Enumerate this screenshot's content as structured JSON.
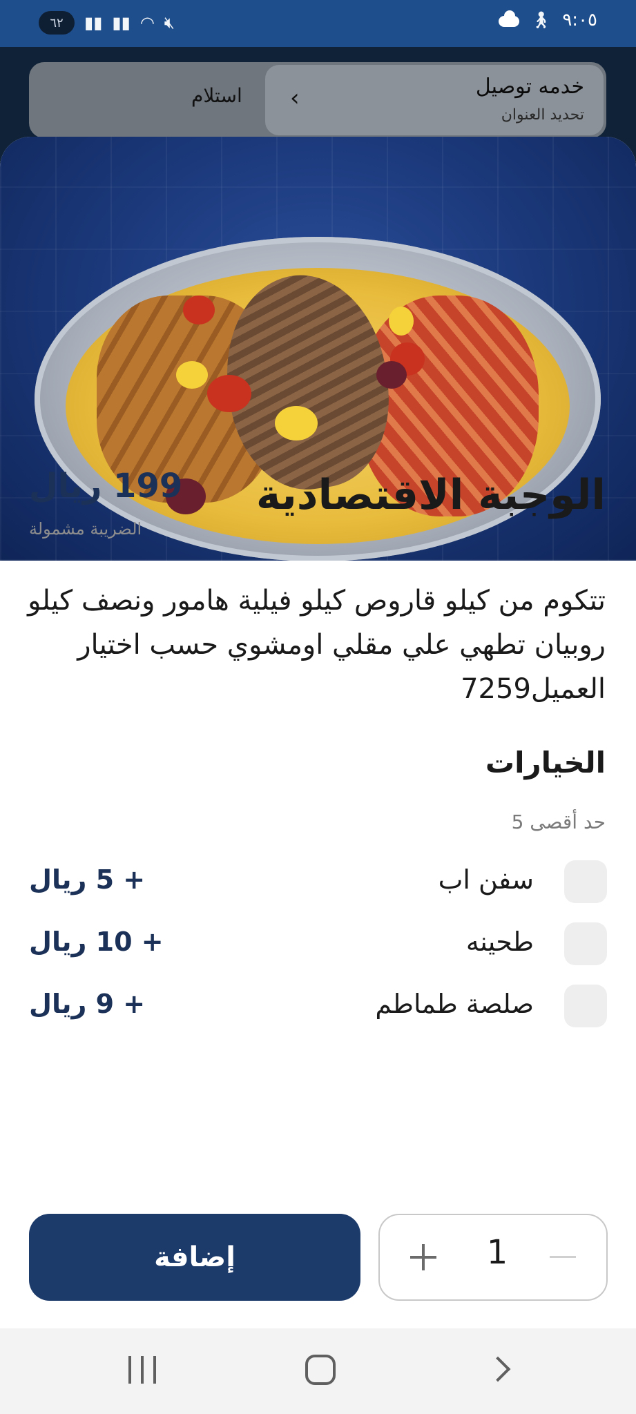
{
  "status_bar": {
    "time": "٩:٠٥",
    "notification_count": "٦٢"
  },
  "order_mode": {
    "delivery_title": "خدمه توصيل",
    "delivery_subtitle": "تحديد العنوان",
    "pickup_label": "استلام"
  },
  "item": {
    "title": "الوجبة الاقتصادية",
    "price": "199 ريال",
    "tax_note": "الضريبة مشمولة",
    "description": "تتكوم من كيلو قاروص كيلو فيلية هامور ونصف كيلو روبيان تطهي علي مقلي اومشوي حسب اختيار العميل7259"
  },
  "options": {
    "title": "الخيارات",
    "max_label": "حد أقصى 5",
    "items": [
      {
        "label": "سفن اب",
        "price": "+ 5 ريال",
        "checked": false
      },
      {
        "label": "طحينه",
        "price": "+ 10 ريال",
        "checked": false
      },
      {
        "label": "صلصة طماطم",
        "price": "+ 9 ريال",
        "checked": false
      }
    ]
  },
  "cart": {
    "add_label": "إضافة",
    "quantity": "1"
  },
  "colors": {
    "primary": "#1c3a6a",
    "status_bar": "#1f4e8c"
  }
}
